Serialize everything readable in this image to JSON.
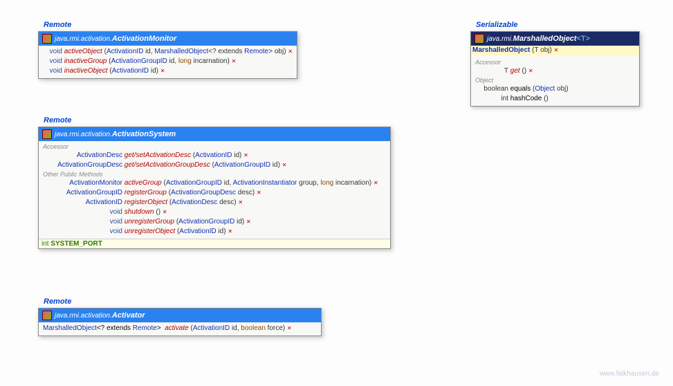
{
  "stereotypes": {
    "remote": "Remote",
    "serializable": "Serializable"
  },
  "activationMonitor": {
    "pkg": "java.rmi.activation.",
    "name": "ActivationMonitor",
    "rows": [
      {
        "ret": "void",
        "method": "activeObject",
        "params": "(ActivationID id, MarshalledObject<? extends Remote> obj)"
      },
      {
        "ret": "void",
        "method": "inactiveGroup",
        "params_pre": "(ActivationGroupID id, ",
        "kw": "long",
        "params_post": " incarnation)"
      },
      {
        "ret": "void",
        "method": "inactiveObject",
        "params": "(ActivationID id)"
      }
    ]
  },
  "activationSystem": {
    "pkg": "java.rmi.activation.",
    "name": "ActivationSystem",
    "sections": {
      "accessor": "Accessor",
      "other": "Other Public Methods"
    },
    "accessor_rows": [
      {
        "ret": "ActivationDesc",
        "method": "get/setActivationDesc",
        "params": "(ActivationID id)"
      },
      {
        "ret": "ActivationGroupDesc",
        "method": "get/setActivationGroupDesc",
        "params": "(ActivationGroupID id)"
      }
    ],
    "other_rows": [
      {
        "ret": "ActivationMonitor",
        "method": "activeGroup",
        "params_pre": "(ActivationGroupID id, ActivationInstantiator group, ",
        "kw": "long",
        "params_post": " incarnation)"
      },
      {
        "ret": "ActivationGroupID",
        "method": "registerGroup",
        "params": "(ActivationGroupDesc desc)"
      },
      {
        "ret": "ActivationID",
        "method": "registerObject",
        "params": "(ActivationDesc desc)"
      },
      {
        "ret": "void",
        "method": "shutdown",
        "params": "()"
      },
      {
        "ret": "void",
        "method": "unregisterGroup",
        "params": "(ActivationGroupID id)"
      },
      {
        "ret": "void",
        "method": "unregisterObject",
        "params": "(ActivationID id)"
      }
    ],
    "field": {
      "type": "int",
      "name": "SYSTEM_PORT"
    }
  },
  "activator": {
    "pkg": "java.rmi.activation.",
    "name": "Activator",
    "row": {
      "ret": "MarshalledObject<? extends Remote>",
      "method": "activate",
      "params_pre": "(ActivationID id, ",
      "kw": "boolean",
      "params_post": " force)"
    }
  },
  "marshalledObject": {
    "pkg": "java.rmi.",
    "name": "MarshalledObject",
    "typeparam": "<T>",
    "constructor": {
      "name": "MarshalledObject",
      "params": "(T obj)"
    },
    "sections": {
      "accessor": "Accessor",
      "object": "Object"
    },
    "accessor_row": {
      "ret": "T",
      "method": "get",
      "params": "()"
    },
    "object_rows": [
      {
        "ret": "boolean",
        "method": "equals",
        "params": "(Object obj)"
      },
      {
        "ret": "int",
        "method": "hashCode",
        "params": "()"
      }
    ]
  },
  "footer": "www.falkhausen.de",
  "throws": "✕"
}
